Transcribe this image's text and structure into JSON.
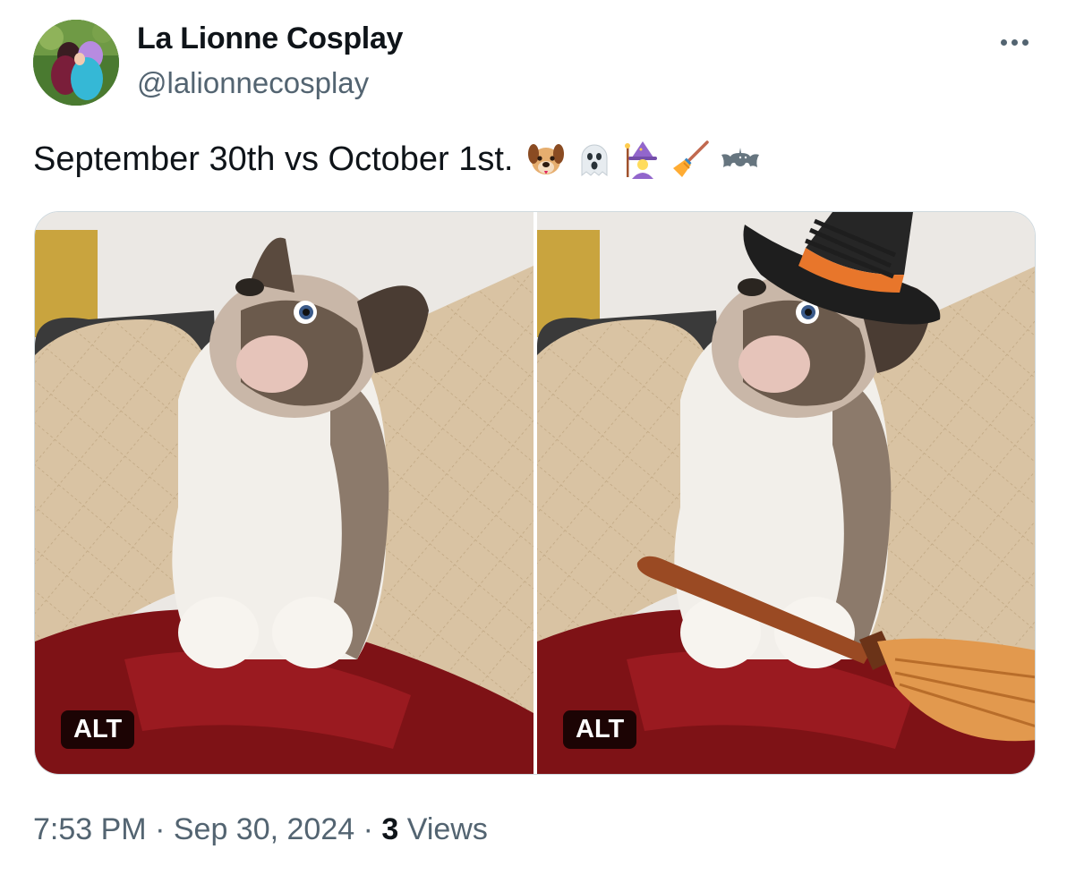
{
  "author": {
    "display_name": "La Lionne Cosplay",
    "handle": "@lalionnecosplay"
  },
  "tweet": {
    "text": "September 30th vs October 1st.",
    "emojis": [
      "dog-face-icon",
      "ghost-icon",
      "mage-icon",
      "broom-icon",
      "bat-icon"
    ]
  },
  "media": {
    "photos": [
      {
        "alt_badge": "ALT",
        "subject": "french-bulldog"
      },
      {
        "alt_badge": "ALT",
        "subject": "french-bulldog-witch-hat-broom"
      }
    ]
  },
  "meta": {
    "time": "7:53 PM",
    "sep1": "·",
    "date": "Sep 30, 2024",
    "sep2": "·",
    "views_count": "3",
    "views_label": "Views"
  },
  "colors": {
    "text_primary": "#0f1419",
    "text_secondary": "#536471",
    "border": "#cfd9de"
  }
}
